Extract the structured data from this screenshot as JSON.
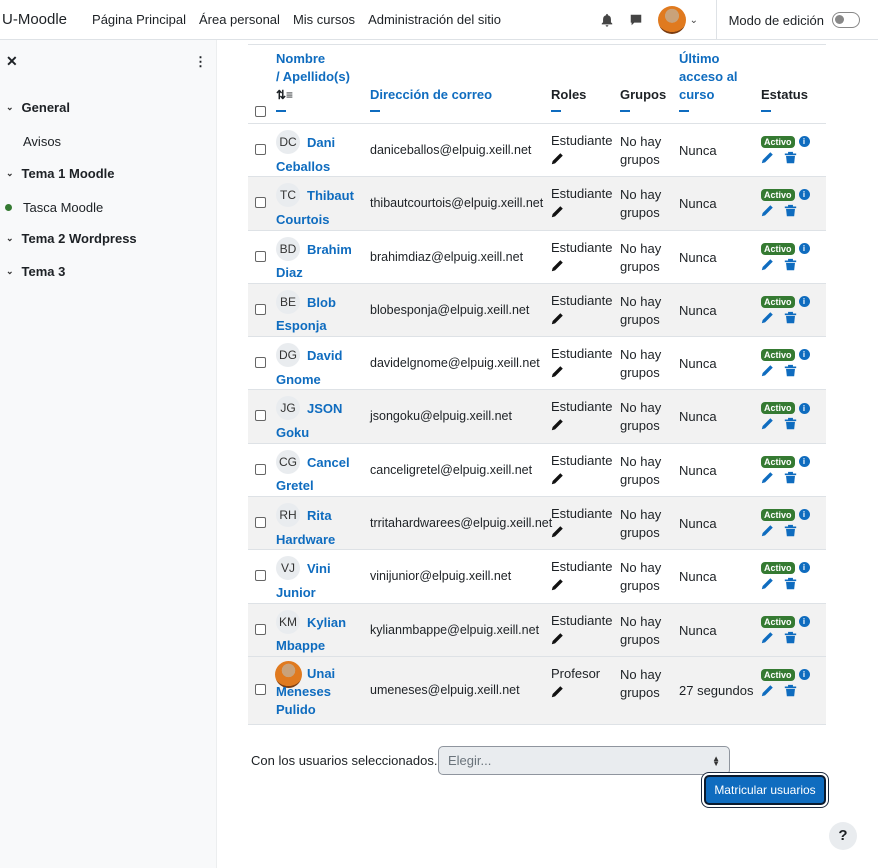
{
  "navbar": {
    "brand": "U-Moodle",
    "links": [
      "Página Principal",
      "Área personal",
      "Mis cursos",
      "Administración del sitio"
    ],
    "edit_mode_label": "Modo de edición"
  },
  "drawer": {
    "sections": [
      {
        "label": "General",
        "items": [
          {
            "label": "Avisos",
            "active": false
          }
        ]
      },
      {
        "label": "Tema 1 Moodle",
        "items": [
          {
            "label": "Tasca Moodle",
            "active": true
          }
        ]
      },
      {
        "label": "Tema 2 Wordpress",
        "items": []
      },
      {
        "label": "Tema 3",
        "items": []
      }
    ]
  },
  "table": {
    "headers": {
      "name": "Nombre",
      "surname": "/ Apellido(s)",
      "email": "Dirección de correo",
      "roles": "Roles",
      "groups": "Grupos",
      "last_access": "Último acceso al curso",
      "status": "Estatus"
    },
    "rows": [
      {
        "initials": "DC",
        "first": "Dani",
        "last": "Ceballos",
        "email": "daniceballos@elpuig.xeill.net",
        "role": "Estudiante",
        "groups": "No hay grupos",
        "access": "Nunca",
        "status": "Activo"
      },
      {
        "initials": "TC",
        "first": "Thibaut",
        "last": "Courtois",
        "email": "thibautcourtois@elpuig.xeill.net",
        "role": "Estudiante",
        "groups": "No hay grupos",
        "access": "Nunca",
        "status": "Activo"
      },
      {
        "initials": "BD",
        "first": "Brahim",
        "last": "Diaz",
        "email": "brahimdiaz@elpuig.xeill.net",
        "role": "Estudiante",
        "groups": "No hay grupos",
        "access": "Nunca",
        "status": "Activo"
      },
      {
        "initials": "BE",
        "first": "Blob",
        "last": "Esponja",
        "email": "blobesponja@elpuig.xeill.net",
        "role": "Estudiante",
        "groups": "No hay grupos",
        "access": "Nunca",
        "status": "Activo"
      },
      {
        "initials": "DG",
        "first": "David",
        "last": "Gnome",
        "email": "davidelgnome@elpuig.xeill.net",
        "role": "Estudiante",
        "groups": "No hay grupos",
        "access": "Nunca",
        "status": "Activo"
      },
      {
        "initials": "JG",
        "first": "JSON",
        "last": "Goku",
        "email": "jsongoku@elpuig.xeill.net",
        "role": "Estudiante",
        "groups": "No hay grupos",
        "access": "Nunca",
        "status": "Activo"
      },
      {
        "initials": "CG",
        "first": "Cancel",
        "last": "Gretel",
        "email": "canceligretel@elpuig.xeill.net",
        "role": "Estudiante",
        "groups": "No hay grupos",
        "access": "Nunca",
        "status": "Activo"
      },
      {
        "initials": "RH",
        "first": "Rita",
        "last": "Hardware",
        "email": "trritahardwarees@elpuig.xeill.net",
        "role": "Estudiante",
        "groups": "No hay grupos",
        "access": "Nunca",
        "status": "Activo"
      },
      {
        "initials": "VJ",
        "first": "Vini",
        "last": "Junior",
        "email": "vinijunior@elpuig.xeill.net",
        "role": "Estudiante",
        "groups": "No hay grupos",
        "access": "Nunca",
        "status": "Activo"
      },
      {
        "initials": "KM",
        "first": "Kylian",
        "last": "Mbappe",
        "email": "kylianmbappe@elpuig.xeill.net",
        "role": "Estudiante",
        "groups": "No hay grupos",
        "access": "Nunca",
        "status": "Activo"
      },
      {
        "initials": "",
        "first": "Unai",
        "last": "Meneses Pulido",
        "email": "umeneses@elpuig.xeill.net",
        "role": "Profesor",
        "groups": "No hay grupos",
        "access": "27 segundos",
        "status": "Activo"
      }
    ]
  },
  "bulk": {
    "label": "Con los usuarios seleccionados...",
    "select_value": "Elegir..."
  },
  "enrol_button": "Matricular usuarios",
  "help": "?"
}
